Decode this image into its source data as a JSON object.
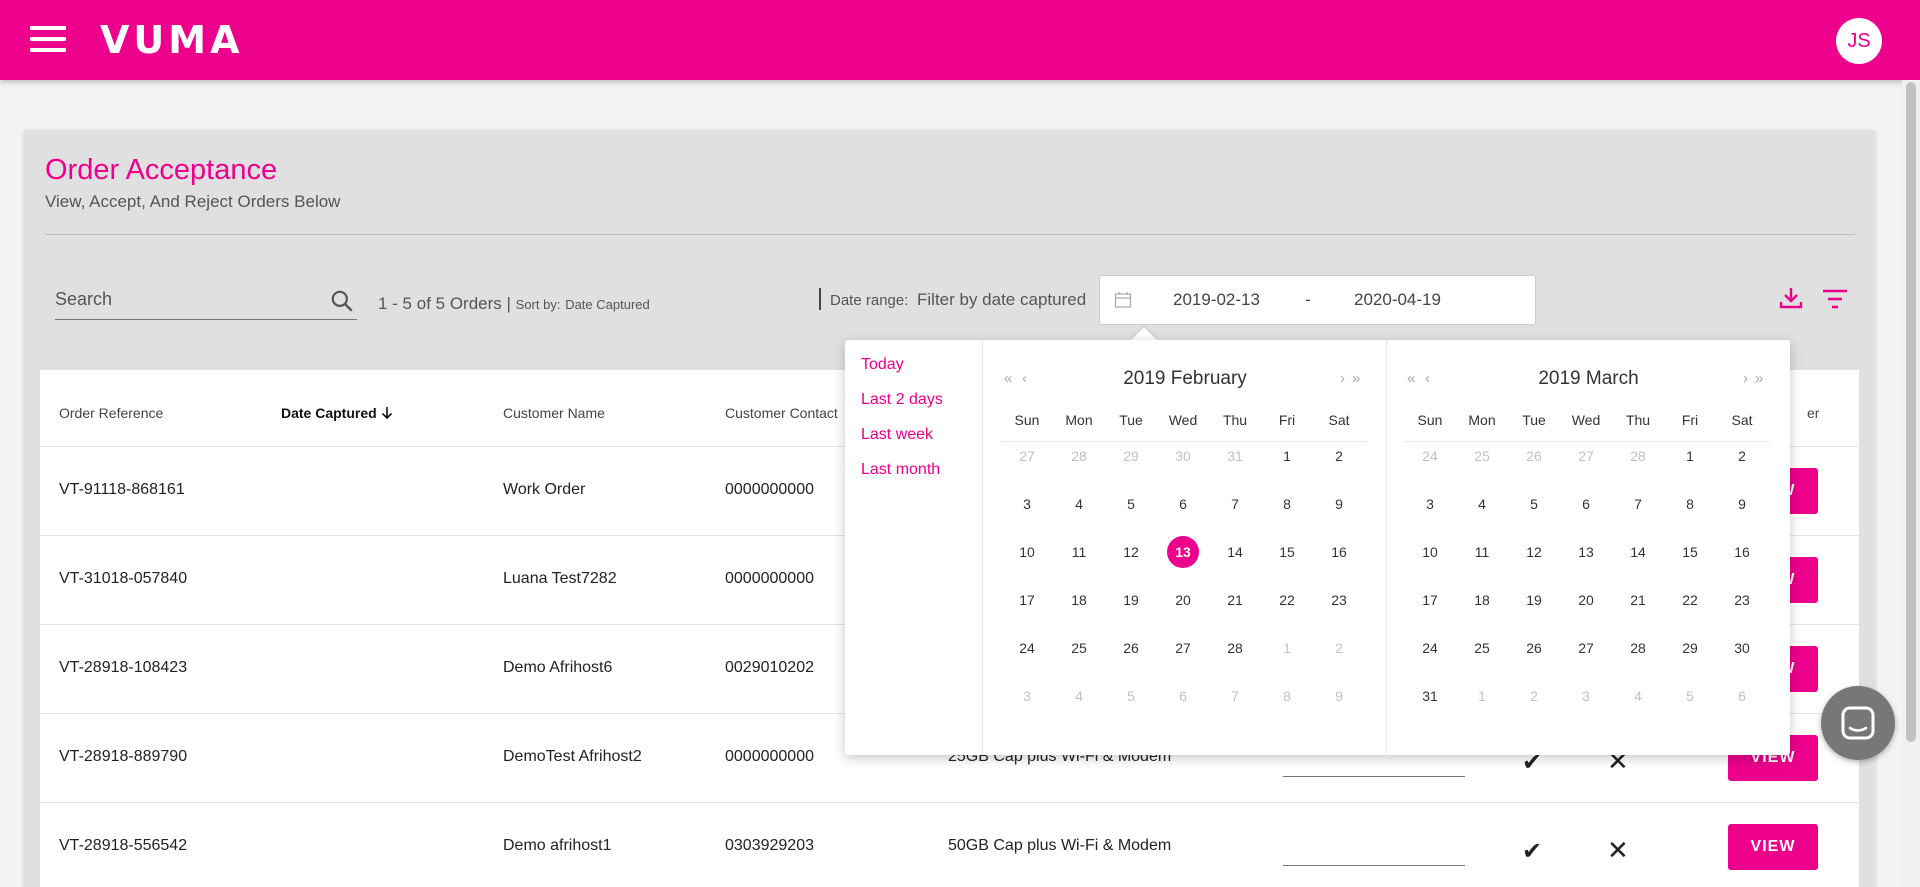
{
  "header": {
    "logo": "VUMA",
    "avatar_initials": "JS"
  },
  "page": {
    "title": "Order Acceptance",
    "subtitle": "View, Accept, And Reject Orders Below"
  },
  "toolbar": {
    "search_placeholder": "Search",
    "count_text": "1 - 5 of 5 Orders |",
    "sort_label": "Sort by:",
    "sort_value": "Date Captured",
    "date_range_label": "Date range:",
    "date_filter_text": "Filter by date captured",
    "date_start": "2019-02-13",
    "date_separator": "-",
    "date_end": "2020-04-19"
  },
  "table": {
    "headers": [
      "Order Reference",
      "Date Captured",
      "Customer Name",
      "Customer Contact",
      "er"
    ],
    "rows": [
      {
        "ref": "VT-91118-868161",
        "name": "Work Order",
        "contact": "0000000000",
        "product": ""
      },
      {
        "ref": "VT-31018-057840",
        "name": "Luana Test7282",
        "contact": "0000000000",
        "product": ""
      },
      {
        "ref": "VT-28918-108423",
        "name": "Demo Afrihost6",
        "contact": "0029010202",
        "product": ""
      },
      {
        "ref": "VT-28918-889790",
        "name": "DemoTest Afrihost2",
        "contact": "0000000000",
        "product": "25GB Cap plus Wi-Fi & Modem"
      },
      {
        "ref": "VT-28918-556542",
        "name": "Demo afrihost1",
        "contact": "0303929203",
        "product": "50GB Cap plus Wi-Fi & Modem"
      }
    ],
    "view_label": "VIEW"
  },
  "datepicker": {
    "presets": [
      "Today",
      "Last 2 days",
      "Last week",
      "Last month"
    ],
    "weekdays": [
      "Sun",
      "Mon",
      "Tue",
      "Wed",
      "Thu",
      "Fri",
      "Sat"
    ],
    "left": {
      "title": "2019 February",
      "days": [
        "27",
        "28",
        "29",
        "30",
        "31",
        "1",
        "2",
        "3",
        "4",
        "5",
        "6",
        "7",
        "8",
        "9",
        "10",
        "11",
        "12",
        "13",
        "14",
        "15",
        "16",
        "17",
        "18",
        "19",
        "20",
        "21",
        "22",
        "23",
        "24",
        "25",
        "26",
        "27",
        "28",
        "1",
        "2",
        "3",
        "4",
        "5",
        "6",
        "7",
        "8",
        "9"
      ],
      "muted": [
        0,
        1,
        2,
        3,
        4,
        33,
        34,
        35,
        36,
        37,
        38,
        39,
        40,
        41
      ],
      "selected": 17
    },
    "right": {
      "title": "2019 March",
      "days": [
        "24",
        "25",
        "26",
        "27",
        "28",
        "1",
        "2",
        "3",
        "4",
        "5",
        "6",
        "7",
        "8",
        "9",
        "10",
        "11",
        "12",
        "13",
        "14",
        "15",
        "16",
        "17",
        "18",
        "19",
        "20",
        "21",
        "22",
        "23",
        "24",
        "25",
        "26",
        "27",
        "28",
        "29",
        "30",
        "31",
        "1",
        "2",
        "3",
        "4",
        "5",
        "6"
      ],
      "muted": [
        0,
        1,
        2,
        3,
        4,
        36,
        37,
        38,
        39,
        40,
        41
      ],
      "selected": -1
    }
  }
}
